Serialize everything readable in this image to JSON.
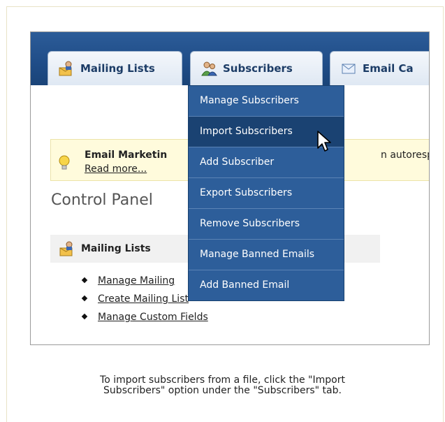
{
  "tabs": [
    {
      "label": "Mailing Lists",
      "icon": "mailing-lists-icon"
    },
    {
      "label": "Subscribers",
      "icon": "subscribers-icon"
    },
    {
      "label": "Email Ca",
      "icon": "envelope-icon"
    }
  ],
  "notice": {
    "title": "Email Marketin",
    "tail": "n autoresponde",
    "read_more": "Read more..."
  },
  "control_panel": {
    "title": "Control Panel",
    "section_title": "Mailing Lists",
    "links": [
      "Manage Mailing",
      "Create Mailing List",
      "Manage Custom Fields"
    ]
  },
  "dropdown": {
    "items": [
      "Manage Subscribers",
      "Import Subscribers",
      "Add Subscriber",
      "Export Subscribers",
      "Remove Subscribers",
      "Manage Banned Emails",
      "Add Banned Email"
    ],
    "active": "Import Subscribers"
  },
  "caption": {
    "line1": "To import subscribers from a file, click the \"Import",
    "line2": "Subscribers\" option under the \"Subscribers\" tab."
  },
  "colors": {
    "topbar": "#1f4c87",
    "menu": "#2d5e9a",
    "menu_active": "#1a4272",
    "notice_bg": "#fffbdc"
  }
}
